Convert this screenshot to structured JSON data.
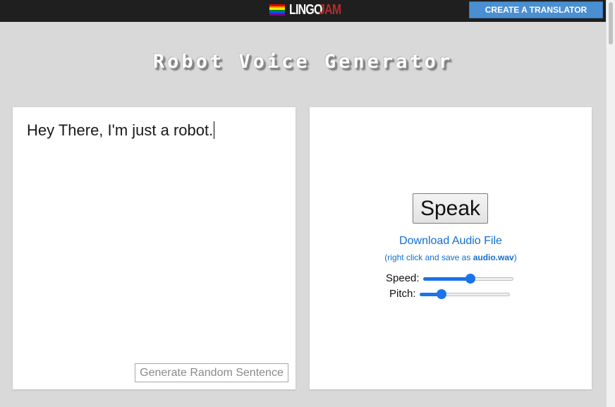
{
  "header": {
    "logo_part1": "LINGO",
    "logo_part2": "JAM",
    "create_button": "CREATE A TRANSLATOR",
    "flag_colors": [
      "#e40303",
      "#ff8c00",
      "#ffed00",
      "#008026",
      "#004dff",
      "#750787"
    ]
  },
  "page": {
    "title": "Robot Voice Generator"
  },
  "input_panel": {
    "text": "Hey There, I'm just a robot.",
    "random_button": "Generate Random Sentence"
  },
  "output_panel": {
    "speak_button": "Speak",
    "download_link": "Download Audio File",
    "download_note_prefix": "(right click and save as ",
    "download_note_file": "audio.wav",
    "download_note_suffix": ")",
    "speed_label": "Speed:",
    "speed_value": 0.52,
    "pitch_label": "Pitch:",
    "pitch_value": 0.24
  },
  "colors": {
    "accent": "#1a73e8",
    "link": "#0f6fd1",
    "button_blue": "#4a8fd1",
    "background": "#d9d9d9"
  }
}
